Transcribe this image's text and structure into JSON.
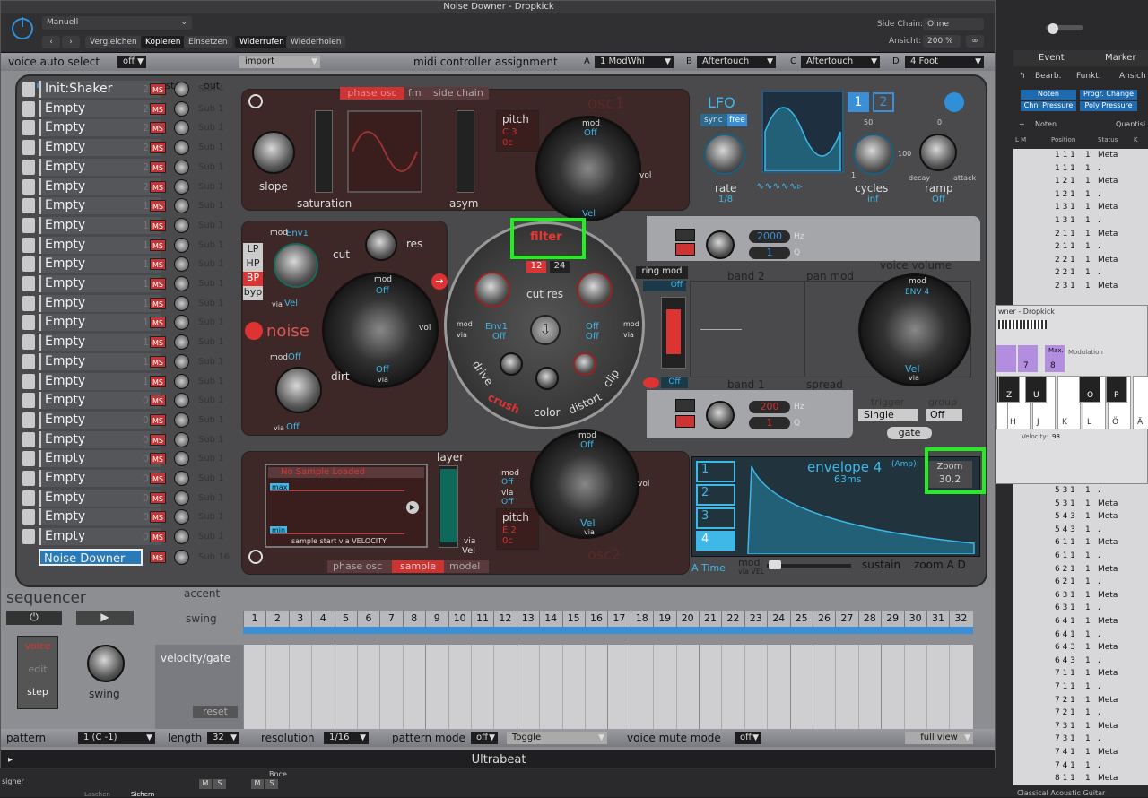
{
  "window": {
    "title": "Noise Downer - Dropkick",
    "footer": "Ultrabeat"
  },
  "plugin_header": {
    "preset": "Manuell",
    "compare": "Vergleichen",
    "copy": "Kopieren",
    "paste": "Einsetzen",
    "undo": "Widerrufen",
    "redo": "Wiederholen",
    "side_chain_label": "Side Chain:",
    "side_chain_value": "Ohne",
    "view_label": "Ansicht:",
    "view_value": "200 %"
  },
  "control_row": {
    "voice_auto_select": "voice auto select",
    "vas_value": "off",
    "import": "import",
    "midi_assign": "midi controller assignment",
    "a_label": "A",
    "a_value": "1 ModWhl",
    "b_label": "B",
    "b_value": "Aftertouch",
    "c_label": "C",
    "c_value": "Aftertouch",
    "d_label": "D",
    "d_value": "4 Foot"
  },
  "voices_header": {
    "master": "master",
    "out": "out"
  },
  "voices": [
    {
      "name": "Init:Shaker",
      "num": "25",
      "out": "Sub 4"
    },
    {
      "name": "Empty",
      "num": "24",
      "out": "Sub 1"
    },
    {
      "name": "Empty",
      "num": "23",
      "out": "Sub 1"
    },
    {
      "name": "Empty",
      "num": "22",
      "out": "Sub 1"
    },
    {
      "name": "Empty",
      "num": "21",
      "out": "Sub 1"
    },
    {
      "name": "Empty",
      "num": "20",
      "out": "Sub 1"
    },
    {
      "name": "Empty",
      "num": "19",
      "out": "Sub 1"
    },
    {
      "name": "Empty",
      "num": "18",
      "out": "Sub 1"
    },
    {
      "name": "Empty",
      "num": "17",
      "out": "Sub 1"
    },
    {
      "name": "Empty",
      "num": "16",
      "out": "Sub 1"
    },
    {
      "name": "Empty",
      "num": "15",
      "out": "Sub 1"
    },
    {
      "name": "Empty",
      "num": "14",
      "out": "Sub 1"
    },
    {
      "name": "Empty",
      "num": "13",
      "out": "Sub 1"
    },
    {
      "name": "Empty",
      "num": "12",
      "out": "Sub 1"
    },
    {
      "name": "Empty",
      "num": "11",
      "out": "Sub 1"
    },
    {
      "name": "Empty",
      "num": "10",
      "out": "Sub 1"
    },
    {
      "name": "Empty",
      "num": "09",
      "out": "Sub 1"
    },
    {
      "name": "Empty",
      "num": "08",
      "out": "Sub 1"
    },
    {
      "name": "Empty",
      "num": "07",
      "out": "Sub 1"
    },
    {
      "name": "Empty",
      "num": "06",
      "out": "Sub 1"
    },
    {
      "name": "Empty",
      "num": "05",
      "out": "Sub 1"
    },
    {
      "name": "Empty",
      "num": "04",
      "out": "Sub 1"
    },
    {
      "name": "Empty",
      "num": "03",
      "out": "Sub 1"
    },
    {
      "name": "Empty",
      "num": "02",
      "out": "Sub 1"
    }
  ],
  "selected_voice": {
    "name": "Noise Downer",
    "out": "Sub 16"
  },
  "ms_label": "MS",
  "osc1": {
    "tabs": [
      "phase osc",
      "fm",
      "side chain"
    ],
    "title": "osc1",
    "slope": "slope",
    "saturation": "saturation",
    "asym": "asym",
    "pitch": "pitch",
    "pitch_note": "C 3",
    "pitch_oct": "0c",
    "mod": "mod",
    "off": "Off",
    "via": "via",
    "vel": "Vel",
    "vol": "vol"
  },
  "lfo": {
    "title": "LFO",
    "sync": "sync",
    "free": "free",
    "rate": "rate",
    "rate_val": "1/8",
    "cycles": "cycles",
    "cycles_val": "inf",
    "ramp": "ramp",
    "ramp_val": "Off",
    "decay": "decay",
    "attack": "attack",
    "tab1": "1",
    "tab2": "2",
    "fifty": "50",
    "hundred": "100",
    "one": "1",
    "zero": "0"
  },
  "filter": {
    "title": "filter",
    "modes": [
      "LP",
      "HP",
      "BP",
      "byp"
    ],
    "mode_sel": "BP",
    "cut": "cut",
    "res": "res",
    "slope12": "12",
    "slope24": "24",
    "cutres": "cut res",
    "env1": "Env1",
    "off": "Off",
    "drive": "drive",
    "crush": "crush",
    "color": "color",
    "distort": "distort",
    "clip": "clip",
    "mod": "mod",
    "via": "via"
  },
  "noise": {
    "title": "noise",
    "mod": "mod",
    "off": "Off",
    "env1": "Env1",
    "vel": "Vel",
    "dirt": "dirt",
    "via": "via",
    "vol": "vol"
  },
  "eq": {
    "ring_mod": "ring mod",
    "ring_off": "Off",
    "band2": "band 2",
    "band1": "band 1",
    "hz2": "2000",
    "q2": "1",
    "hz1": "200",
    "q1": "1",
    "hz": "Hz",
    "q": "Q",
    "pan_mod": "pan mod",
    "spread": "spread",
    "off": "Off"
  },
  "voice_volume": {
    "title": "voice volume",
    "mod": "mod",
    "env4": "ENV 4",
    "vel": "Vel",
    "via": "via",
    "trigger": "trigger",
    "trigger_val": "Single",
    "group": "group",
    "group_val": "Off",
    "gate": "gate"
  },
  "osc2": {
    "title": "osc2",
    "tabs": [
      "phase osc",
      "sample",
      "model"
    ],
    "sample_name": "No Sample Loaded",
    "max": "max",
    "min": "min",
    "sample_start": "sample start via VELOCITY",
    "layer": "layer",
    "vel": "Vel",
    "via": "via",
    "pitch": "pitch",
    "pitch_note": "E 2",
    "pitch_oct": "0c",
    "mod": "mod",
    "off": "Off",
    "vol": "vol"
  },
  "envelope": {
    "title": "envelope 4",
    "subtitle": "(Amp)",
    "time": "63ms",
    "zoom": "Zoom",
    "zoom_val": "30.2",
    "a_time": "A Time",
    "mod": "mod",
    "via_vel": "via VEL",
    "sustain": "sustain",
    "zoom_ad": "zoom A D",
    "tabs": [
      "1",
      "2",
      "3",
      "4"
    ]
  },
  "sequencer": {
    "title": "sequencer",
    "accent": "accent",
    "swing": "swing",
    "voice": "voice",
    "edit": "edit",
    "step": "step",
    "swing_knob": "swing",
    "velgate": "velocity/gate",
    "reset": "reset",
    "steps": [
      "1",
      "2",
      "3",
      "4",
      "5",
      "6",
      "7",
      "8",
      "9",
      "10",
      "11",
      "12",
      "13",
      "14",
      "15",
      "16",
      "17",
      "18",
      "19",
      "20",
      "21",
      "22",
      "23",
      "24",
      "25",
      "26",
      "27",
      "28",
      "29",
      "30",
      "31",
      "32"
    ]
  },
  "bottom": {
    "pattern": "pattern",
    "pattern_val": "1 (C -1)",
    "length": "length",
    "length_val": "32",
    "resolution": "resolution",
    "resolution_val": "1/16",
    "pattern_mode": "pattern mode",
    "pm_val": "off",
    "toggle": "Toggle",
    "voice_mute": "voice mute mode",
    "vm_val": "off",
    "full_view": "full view"
  },
  "right_app": {
    "tab_event": "Event",
    "tab_marker": "Marker",
    "edit": "Bearb.",
    "funct": "Funkt.",
    "view": "Ansich",
    "btn_notes": "Noten",
    "btn_prog": "Progr. Change",
    "btn_chnl": "Chnl Pressure",
    "btn_poly": "Poly Pressure",
    "notes_label": "Noten",
    "quant": "Quantisi",
    "col_lm": "L M",
    "col_pos": "Position",
    "col_status": "Status",
    "col_k": "K",
    "rows": [
      {
        "pos": "1 1 1",
        "a": "1",
        "s": "Meta"
      },
      {
        "pos": "1 1 1",
        "a": "1",
        "s": "♩"
      },
      {
        "pos": "1 2 1",
        "a": "1",
        "s": "Meta"
      },
      {
        "pos": "1 2 1",
        "a": "1",
        "s": "♩"
      },
      {
        "pos": "1 3 1",
        "a": "1",
        "s": "Meta"
      },
      {
        "pos": "1 3 1",
        "a": "1",
        "s": "♩"
      },
      {
        "pos": "2 1 1",
        "a": "1",
        "s": "Meta"
      },
      {
        "pos": "2 1 1",
        "a": "1",
        "s": "♩"
      },
      {
        "pos": "2 2 1",
        "a": "1",
        "s": "Meta"
      },
      {
        "pos": "2 2 1",
        "a": "1",
        "s": "♩"
      },
      {
        "pos": "2 3 1",
        "a": "1",
        "s": "Meta"
      },
      {
        "pos": "5 3 1",
        "a": "1",
        "s": "♩"
      },
      {
        "pos": "5 3 1",
        "a": "1",
        "s": "Meta"
      },
      {
        "pos": "5 4 3",
        "a": "1",
        "s": "Meta"
      },
      {
        "pos": "5 4 3",
        "a": "1",
        "s": "♩"
      },
      {
        "pos": "6 1 1",
        "a": "1",
        "s": "Meta"
      },
      {
        "pos": "6 1 1",
        "a": "1",
        "s": "♩"
      },
      {
        "pos": "6 2 1",
        "a": "1",
        "s": "Meta"
      },
      {
        "pos": "6 2 1",
        "a": "1",
        "s": "♩"
      },
      {
        "pos": "6 3 1",
        "a": "1",
        "s": "Meta"
      },
      {
        "pos": "6 3 1",
        "a": "1",
        "s": "♩"
      },
      {
        "pos": "6 4 1",
        "a": "1",
        "s": "Meta"
      },
      {
        "pos": "6 4 1",
        "a": "1",
        "s": "♩"
      },
      {
        "pos": "6 4 3",
        "a": "1",
        "s": "Meta"
      },
      {
        "pos": "6 4 3",
        "a": "1",
        "s": "♩"
      },
      {
        "pos": "7 1 1",
        "a": "1",
        "s": "Meta"
      },
      {
        "pos": "7 1 1",
        "a": "1",
        "s": "♩"
      },
      {
        "pos": "7 2 1",
        "a": "1",
        "s": "Meta"
      },
      {
        "pos": "7 2 1",
        "a": "1",
        "s": "♩"
      },
      {
        "pos": "7 3 1",
        "a": "1",
        "s": "Meta"
      },
      {
        "pos": "7 3 1",
        "a": "1",
        "s": "♩"
      },
      {
        "pos": "7 4 1",
        "a": "1",
        "s": "Meta"
      },
      {
        "pos": "7 4 1",
        "a": "1",
        "s": "♩"
      },
      {
        "pos": "8 1 1",
        "a": "1",
        "s": "Meta"
      }
    ],
    "bottom_label": "Classical Acoustic Guitar"
  },
  "popup": {
    "title": "wner - Dropkick",
    "max": "Max.",
    "modulation": "Modulation",
    "n7": "7",
    "n8": "8",
    "z": "Z",
    "u": "U",
    "o": "O",
    "p": "P",
    "h": "H",
    "j": "J",
    "k": "K",
    "l": "L",
    "oe": "Ö",
    "ae": "Ä",
    "velocity": "Velocity:",
    "vel_val": "98"
  },
  "bottom_strip": {
    "signer": "signer",
    "bnce": "Bnce",
    "m": "M",
    "s": "S",
    "lasche": "Laschen",
    "sichern": "Sichern"
  }
}
